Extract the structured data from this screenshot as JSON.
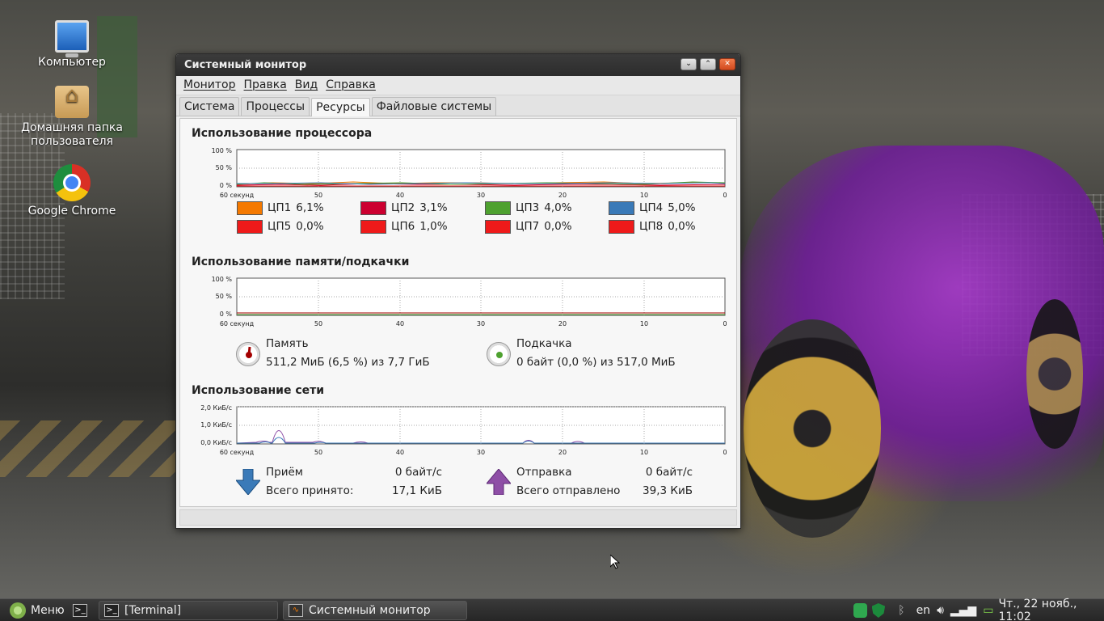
{
  "desktop": {
    "icons": [
      {
        "label": "Компьютер"
      },
      {
        "label": "Домашняя папка пользователя"
      },
      {
        "label": "Google Chrome"
      }
    ]
  },
  "window": {
    "title": "Системный монитор",
    "controls": {
      "minimize": "⌄",
      "maximize": "⌃",
      "close": "✕"
    },
    "menu": [
      "Монитор",
      "Правка",
      "Вид",
      "Справка"
    ],
    "tabs": [
      "Система",
      "Процессы",
      "Ресурсы",
      "Файловые системы"
    ],
    "active_tab": "Ресурсы"
  },
  "cpu": {
    "title": "Использование процессора",
    "yticks": [
      "100 %",
      "50 %",
      "0 %"
    ],
    "xticks": [
      "60 секунд",
      "50",
      "40",
      "30",
      "20",
      "10",
      "0"
    ],
    "cores": [
      {
        "name": "ЦП1",
        "value": "6,1%",
        "color": "#f57900"
      },
      {
        "name": "ЦП2",
        "value": "3,1%",
        "color": "#cc0030"
      },
      {
        "name": "ЦП3",
        "value": "4,0%",
        "color": "#4ea12f"
      },
      {
        "name": "ЦП4",
        "value": "5,0%",
        "color": "#3a7ab8"
      },
      {
        "name": "ЦП5",
        "value": "0,0%",
        "color": "#ef1a1a"
      },
      {
        "name": "ЦП6",
        "value": "1,0%",
        "color": "#ef1a1a"
      },
      {
        "name": "ЦП7",
        "value": "0,0%",
        "color": "#ef1a1a"
      },
      {
        "name": "ЦП8",
        "value": "0,0%",
        "color": "#ef1a1a"
      }
    ]
  },
  "memory": {
    "title": "Использование памяти/подкачки",
    "yticks": [
      "100 %",
      "50 %",
      "0 %"
    ],
    "xticks": [
      "60 секунд",
      "50",
      "40",
      "30",
      "20",
      "10",
      "0"
    ],
    "mem_label": "Память",
    "mem_value": "511,2 МиБ (6,5 %) из 7,7 ГиБ",
    "swap_label": "Подкачка",
    "swap_value": "0 байт (0,0 %) из 517,0 МиБ",
    "mem_color": "#a40000",
    "swap_color": "#4ea12f"
  },
  "network": {
    "title": "Использование сети",
    "yticks": [
      "2,0 КиБ/с",
      "1,0 КиБ/с",
      "0,0 КиБ/с"
    ],
    "xticks": [
      "60 секунд",
      "50",
      "40",
      "30",
      "20",
      "10",
      "0"
    ],
    "recv_label": "Приём",
    "recv_rate": "0 байт/с",
    "recv_total_label": "Всего принято:",
    "recv_total": "17,1 КиБ",
    "send_label": "Отправка",
    "send_rate": "0 байт/с",
    "send_total_label": "Всего отправлено",
    "send_total": "39,3 КиБ",
    "recv_color": "#3a7ab8",
    "send_color": "#8e4ea6"
  },
  "taskbar": {
    "menu_label": "Меню",
    "tasks": [
      "[Terminal]",
      "Системный монитор"
    ],
    "lang": "en",
    "clock": "Чт., 22 нояб., 11:02"
  }
}
